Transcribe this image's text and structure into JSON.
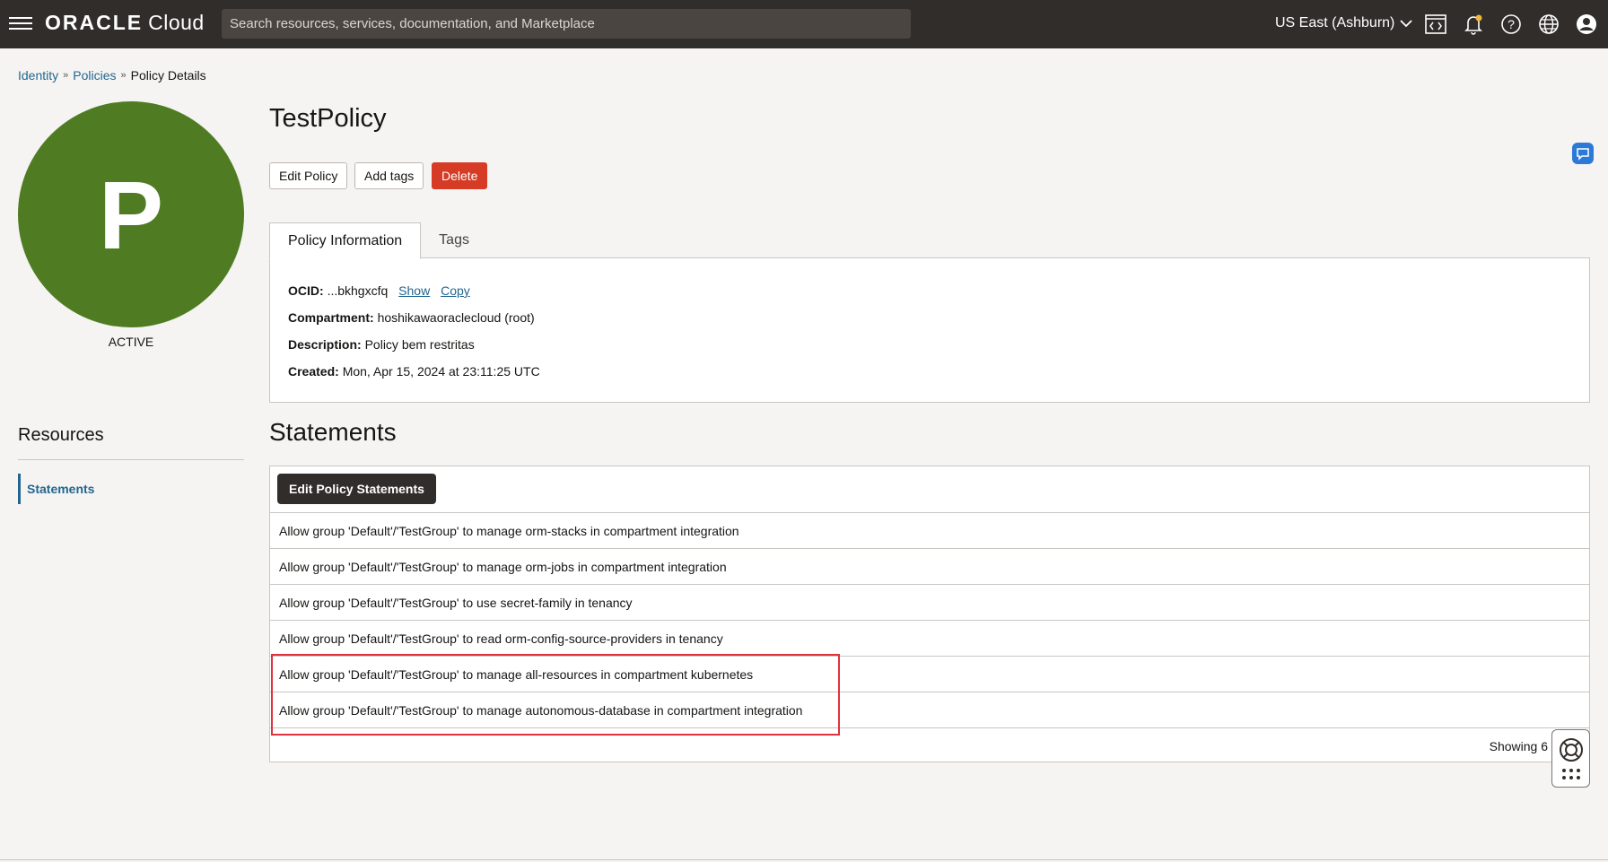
{
  "header": {
    "logo_brand": "ORACLE",
    "logo_product": "Cloud",
    "search_placeholder": "Search resources, services, documentation, and Marketplace",
    "region": "US East (Ashburn)",
    "icons": [
      "menu-icon",
      "code-editor-icon",
      "bell-icon",
      "help-icon",
      "globe-icon",
      "user-icon"
    ]
  },
  "breadcrumb": {
    "items": [
      "Identity",
      "Policies"
    ],
    "current": "Policy Details",
    "separator": "»"
  },
  "resource": {
    "initial": "P",
    "status": "ACTIVE",
    "avatar_color": "#4f7c23"
  },
  "sidebar": {
    "title": "Resources",
    "items": [
      {
        "label": "Statements"
      }
    ]
  },
  "page": {
    "title": "TestPolicy",
    "actions": {
      "edit": "Edit Policy",
      "tags": "Add tags",
      "delete": "Delete"
    },
    "tabs": [
      {
        "label": "Policy Information",
        "active": true
      },
      {
        "label": "Tags",
        "active": false
      }
    ]
  },
  "info": {
    "ocid_label": "OCID:",
    "ocid_value": "...bkhgxcfq",
    "show": "Show",
    "copy": "Copy",
    "compartment_label": "Compartment:",
    "compartment_value": "hoshikawaoraclecloud (root)",
    "description_label": "Description:",
    "description_value": "Policy bem restritas",
    "created_label": "Created:",
    "created_value": "Mon, Apr 15, 2024 at 23:11:25 UTC"
  },
  "statements": {
    "title": "Statements",
    "edit_button": "Edit Policy Statements",
    "rows": [
      "Allow group 'Default'/'TestGroup' to manage orm-stacks in compartment integration",
      "Allow group 'Default'/'TestGroup' to manage orm-jobs in compartment integration",
      "Allow group 'Default'/'TestGroup' to use secret-family in tenancy",
      "Allow group 'Default'/'TestGroup' to read orm-config-source-providers in tenancy",
      "Allow group 'Default'/'TestGroup' to manage all-resources in compartment kubernetes",
      "Allow group 'Default'/'TestGroup' to manage autonomous-database in compartment integration"
    ],
    "showing": "Showing 6"
  },
  "colors": {
    "topbar": "#312d2a",
    "link": "#22668f",
    "delete": "#d63b25",
    "highlight": "#e0313f"
  }
}
